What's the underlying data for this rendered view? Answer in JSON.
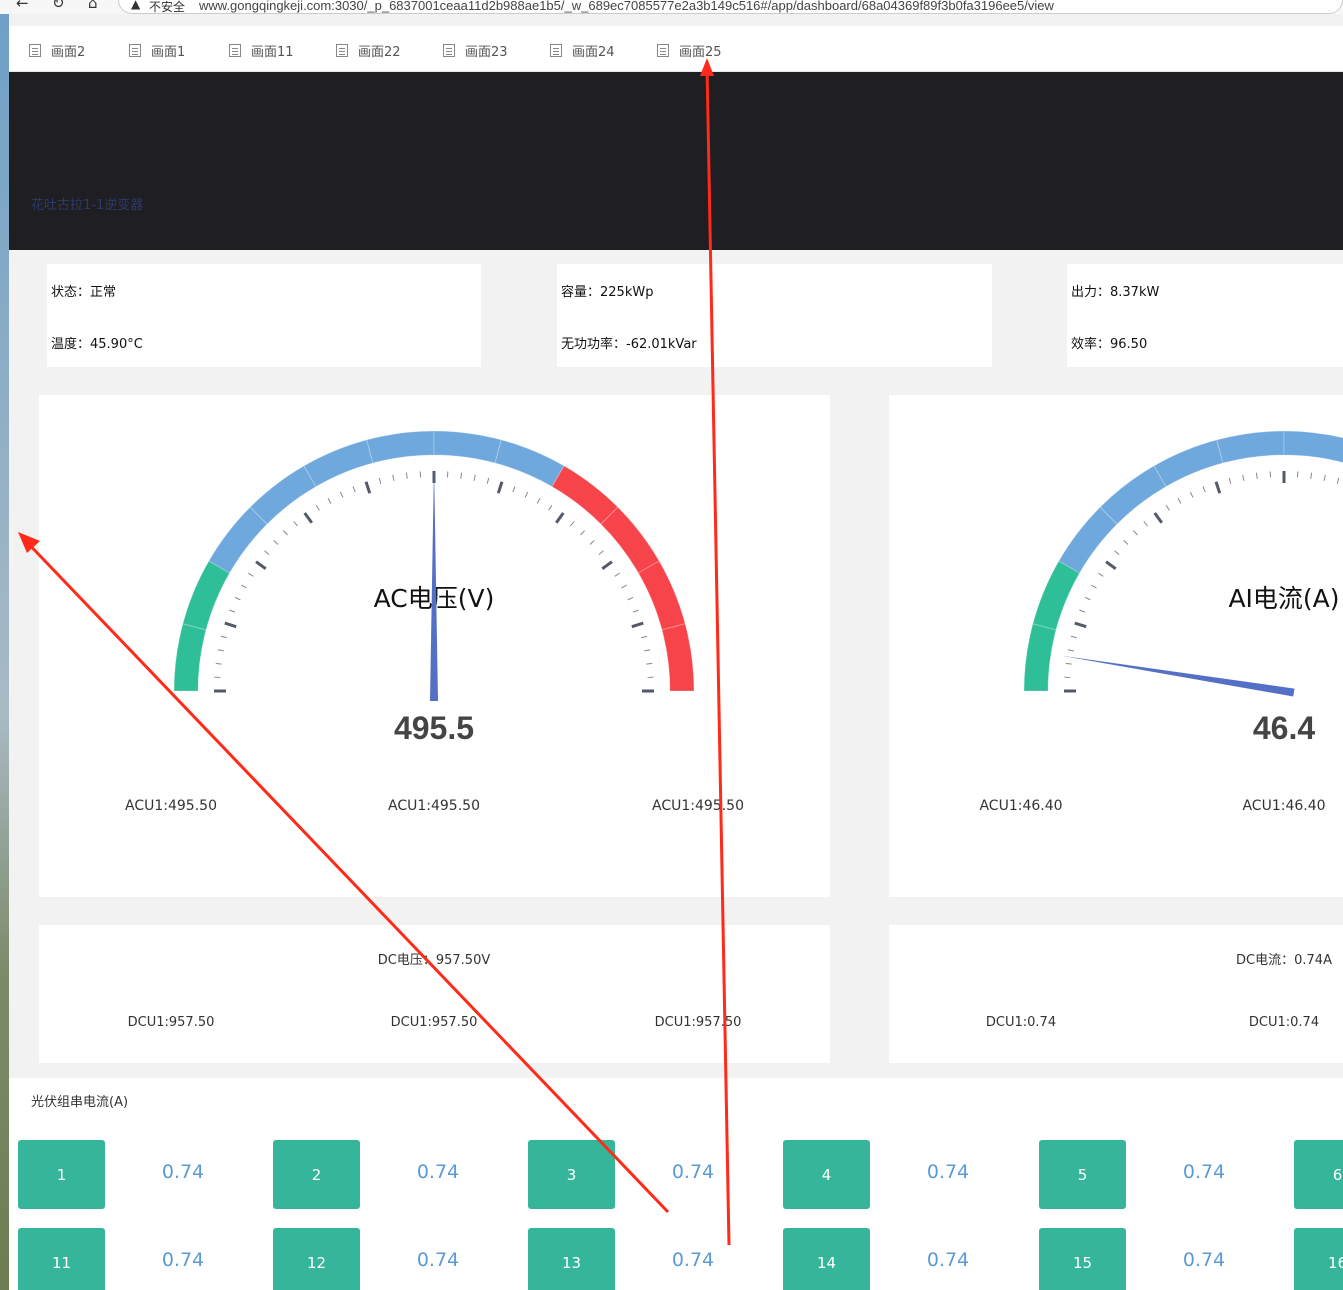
{
  "browser": {
    "back_icon": "arrow-left-icon",
    "reload_icon": "reload-icon",
    "home_icon": "home-icon",
    "security_label": "不安全",
    "url": "www.gongqingkeji.com:3030/_p_6837001ceaa11d2b988ae1b5/_w_689ec7085577e2a3b149c516#/app/dashboard/68a04369f89f3b0fa3196ee5/view"
  },
  "tabs": [
    {
      "label": "画面2"
    },
    {
      "label": "画面1"
    },
    {
      "label": "画面11"
    },
    {
      "label": "画面22"
    },
    {
      "label": "画面23"
    },
    {
      "label": "画面24"
    },
    {
      "label": "画面25"
    }
  ],
  "header": {
    "title": "花吐古拉1-1逆变器"
  },
  "info_cards": [
    {
      "line1": "状态：正常",
      "line2": "温度：45.90°C"
    },
    {
      "line1": "容量：225kWp",
      "line2": "无功功率：-62.01kVar"
    },
    {
      "line1": "出力：8.37kW",
      "line2": "效率：96.50"
    }
  ],
  "gauges": [
    {
      "title": "AC电压(V)",
      "value_text": "495.5",
      "value_fraction": 0.5,
      "labels": [
        "ACU1:495.50",
        "ACU1:495.50",
        "ACU1:495.50"
      ]
    },
    {
      "title": "AI电流(A)",
      "value_text": "46.4",
      "value_fraction": 0.05,
      "labels": [
        "ACU1:46.40",
        "ACU1:46.40"
      ]
    }
  ],
  "dc_panels": [
    {
      "title": "DC电压：957.50V",
      "labels": [
        "DCU1:957.50",
        "DCU1:957.50",
        "DCU1:957.50"
      ]
    },
    {
      "title": "DC电流：0.74A",
      "labels": [
        "DCU1:0.74",
        "DCU1:0.74"
      ]
    }
  ],
  "pv_section": {
    "title": "光伏组串电流(A)",
    "strings": [
      {
        "id": "1",
        "value": "0.74"
      },
      {
        "id": "2",
        "value": "0.74"
      },
      {
        "id": "3",
        "value": "0.74"
      },
      {
        "id": "4",
        "value": "0.74"
      },
      {
        "id": "5",
        "value": "0.74"
      },
      {
        "id": "6",
        "value": ""
      },
      {
        "id": "11",
        "value": "0.74"
      },
      {
        "id": "12",
        "value": "0.74"
      },
      {
        "id": "13",
        "value": "0.74"
      },
      {
        "id": "14",
        "value": "0.74"
      },
      {
        "id": "15",
        "value": "0.74"
      },
      {
        "id": "16",
        "value": ""
      }
    ]
  },
  "colors": {
    "gauge_green": "#2fbf98",
    "gauge_blue": "#6fa8dc",
    "gauge_red": "#f7444b",
    "needle": "#5470c6",
    "pv_box": "#35b59a",
    "pv_value": "#5b9bd5",
    "annotation": "#ff2a1a"
  }
}
